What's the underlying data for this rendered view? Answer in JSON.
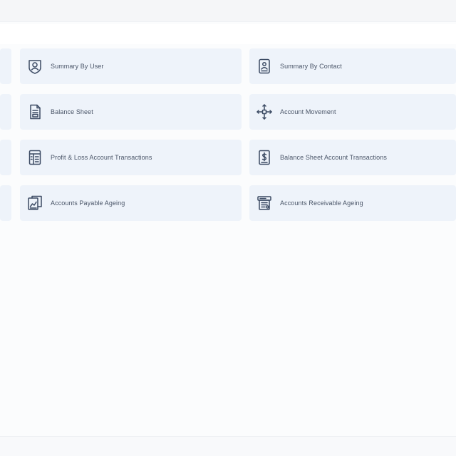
{
  "reports": [
    {
      "label": "Summary By User",
      "icon": "user-badge-icon"
    },
    {
      "label": "Summary By Contact",
      "icon": "contact-card-icon"
    },
    {
      "label": "Balance Sheet",
      "icon": "document-sheet-icon"
    },
    {
      "label": "Account Movement",
      "icon": "move-arrows-icon"
    },
    {
      "label": "Profit & Loss Account Transactions",
      "icon": "ledger-book-icon"
    },
    {
      "label": "Balance Sheet Account Transactions",
      "icon": "dollar-document-icon"
    },
    {
      "label": "Accounts Payable Ageing",
      "icon": "invoice-chart-icon"
    },
    {
      "label": "Accounts Receivable Ageing",
      "icon": "receivable-register-icon"
    }
  ],
  "colors": {
    "card_background": "#eef3fa",
    "icon_stroke": "#3b4a63",
    "label_text": "#4a5568",
    "page_background": "#fbfcfd"
  }
}
